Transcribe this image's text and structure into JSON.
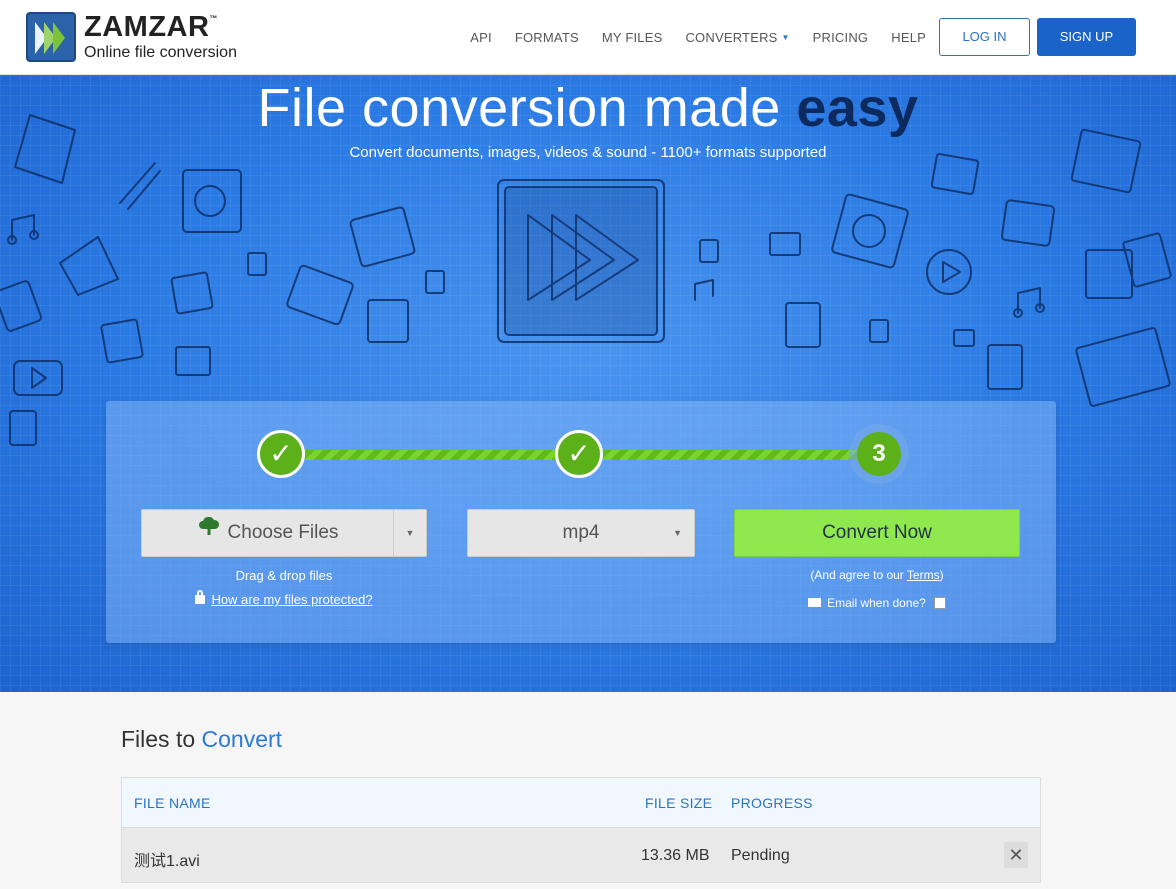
{
  "header": {
    "logo_name": "ZAMZAR",
    "logo_tm": "™",
    "logo_tagline": "Online file conversion",
    "nav": [
      "API",
      "FORMATS",
      "MY FILES",
      "CONVERTERS",
      "PRICING",
      "HELP"
    ],
    "login_label": "LOG IN",
    "signup_label": "SIGN UP"
  },
  "hero": {
    "title_main": "File conversion made",
    "title_bold": "easy",
    "subtitle": "Convert documents, images, videos & sound - 1100+ formats supported"
  },
  "converter": {
    "steps": [
      "✓",
      "✓",
      "3"
    ],
    "choose_files_label": "Choose Files",
    "drag_drop_text": "Drag & drop files",
    "protected_link": "How are my files protected?",
    "format_value": "mp4",
    "convert_label": "Convert Now",
    "terms_prefix": "(And agree to our ",
    "terms_link": "Terms",
    "terms_suffix": ")",
    "email_label": "Email when done?"
  },
  "files": {
    "title_main": "Files to",
    "title_accent": "Convert",
    "columns": [
      "FILE NAME",
      "FILE SIZE",
      "PROGRESS"
    ],
    "rows": [
      {
        "name": "测试1.avi",
        "size": "13.36 MB",
        "progress": "Pending"
      }
    ],
    "remove_symbol": "✕"
  },
  "colors": {
    "hero_bg": "#2a7ae4",
    "accent_green": "#8fe84e",
    "step_green": "#5cb11a",
    "brand_blue": "#1a63c9"
  }
}
